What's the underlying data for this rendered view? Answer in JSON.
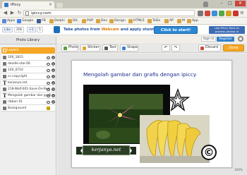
{
  "browser": {
    "tab_title": "iPiccy",
    "url": "ipiccy.com",
    "window_controls": [
      "–",
      "□",
      "✕"
    ]
  },
  "bookmarks": [
    {
      "label": "Apps",
      "color": "#5b8ad6"
    },
    {
      "label": "Google",
      "color": "#4285f4"
    },
    {
      "label": "FB",
      "color": "#3b5998"
    },
    {
      "label": "Delphi",
      "color": "#d9a441"
    },
    {
      "label": "D/L",
      "color": "#d9a441"
    },
    {
      "label": "PHP",
      "color": "#d9a441"
    },
    {
      "label": "Dev",
      "color": "#d9a441"
    },
    {
      "label": "Design",
      "color": "#d9a441"
    },
    {
      "label": "HTML5",
      "color": "#d9a441"
    },
    {
      "label": "ToDo",
      "color": "#d9a441"
    },
    {
      "label": "AP",
      "color": "#d9a441"
    },
    {
      "label": "M",
      "color": "#d9a441"
    },
    {
      "label": "App",
      "color": "#d9a441"
    }
  ],
  "banner": {
    "like_label": "Like",
    "like_count": "20k",
    "gplus_label": "+1",
    "gplus_count": "5",
    "promo_text_before": "Take photos from ",
    "promo_text_highlight": "Webcam",
    "promo_text_after": " and apply stunning effects!",
    "start_button": "Click to start!",
    "store_text": "Use iPiccy Tools to process photos in Firefox"
  },
  "account": {
    "signin": "Sign in",
    "register": "Register"
  },
  "left_panel": {
    "header": "Photo Library",
    "layers_label": "Layers",
    "layers": [
      {
        "label": "100_1815",
        "type": "image",
        "locked": false
      },
      {
        "label": "doodle-star-06",
        "type": "image",
        "locked": false
      },
      {
        "label": "100_0710",
        "type": "image",
        "locked": false
      },
      {
        "label": "cc-copyright",
        "type": "image",
        "locked": false
      },
      {
        "label": "kerjanya.net",
        "type": "text",
        "locked": false
      },
      {
        "label": "218-Wolf-001-Save-On-Red",
        "type": "image",
        "locked": false
      },
      {
        "label": "Mengolah gambar dan grafi",
        "type": "text",
        "locked": false
      },
      {
        "label": "ribbon 01",
        "type": "image",
        "locked": false
      },
      {
        "label": "Background",
        "type": "image",
        "locked": true
      }
    ]
  },
  "editor_toolbar": {
    "photo": "Photo",
    "sticker": "Sticker",
    "text": "Text",
    "shape": "Shape",
    "undo": "↶",
    "redo": "↷",
    "discard": "Discard",
    "done": "Done"
  },
  "canvas": {
    "title": "Mengolah gambar dan grafis dengan ipiccy",
    "ribbon_text": "kerjanya.net",
    "copyright_symbol": "©",
    "zoom": "100%"
  },
  "colors": {
    "accent_orange": "#f5a623",
    "title_blue": "#1c2b8c",
    "start_blue": "#2a88d4"
  }
}
